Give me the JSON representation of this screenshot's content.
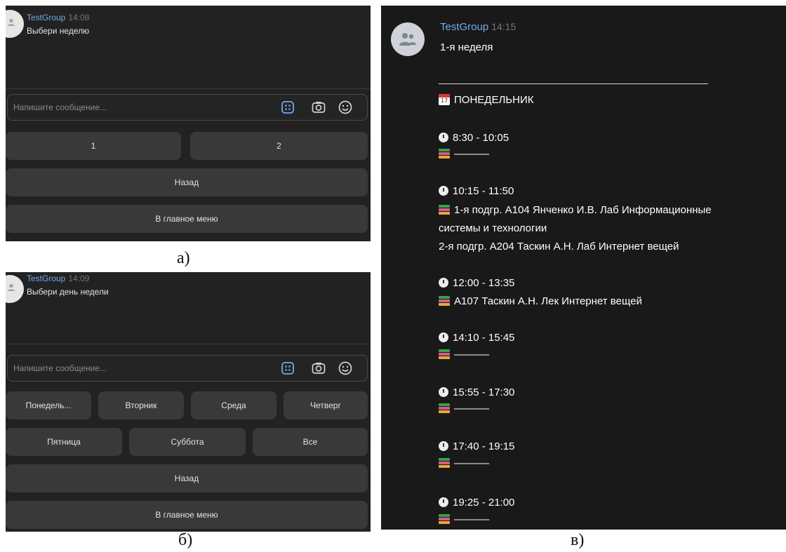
{
  "panel_a": {
    "sender": "TestGroup",
    "time": "14:08",
    "message": "Выбери неделю",
    "composer_placeholder": "Напишите сообщение...",
    "buttons": [
      "1",
      "2"
    ],
    "back": "Назад",
    "main_menu": "В главное меню"
  },
  "panel_b": {
    "sender": "TestGroup",
    "time": "14:09",
    "message": "Выбери день недели",
    "composer_placeholder": "Напишите сообщение...",
    "days_row1": [
      "Понедель...",
      "Вторник",
      "Среда",
      "Четверг"
    ],
    "days_row2": [
      "Пятница",
      "Суббота",
      "Все"
    ],
    "back": "Назад",
    "main_menu": "В главное меню"
  },
  "panel_c": {
    "sender": "TestGroup",
    "time": "14:15",
    "week": "1-я неделя",
    "calendar_day": "17",
    "day": "ПОНЕДЕЛЬНИК",
    "slots": [
      {
        "time": "8:30 - 10:05",
        "lines": [
          "––––––"
        ]
      },
      {
        "time": "10:15 - 11:50",
        "lines": [
          "1-я подгр. А104 Янченко И.В. Лаб Информационные",
          "системы и технологии",
          "2-я подгр. А204 Таскин А.Н. Лаб Интернет вещей"
        ]
      },
      {
        "time": "12:00 - 13:35",
        "lines": [
          "А107 Таскин А.Н. Лек Интернет вещей"
        ]
      },
      {
        "time": "14:10 - 15:45",
        "lines": [
          "––––––"
        ]
      },
      {
        "time": "15:55 - 17:30",
        "lines": [
          "––––––"
        ]
      },
      {
        "time": "17:40 - 19:15",
        "lines": [
          "––––––"
        ]
      },
      {
        "time": "19:25 - 21:00",
        "lines": [
          "––––––"
        ]
      }
    ]
  },
  "captions": {
    "a": "а)",
    "b": "б)",
    "c": "в)"
  },
  "colors": {
    "accent": "#71aaeb",
    "panel_bg": "#222222",
    "button_bg": "#393939",
    "keyboard_icon": "#71aaeb"
  }
}
